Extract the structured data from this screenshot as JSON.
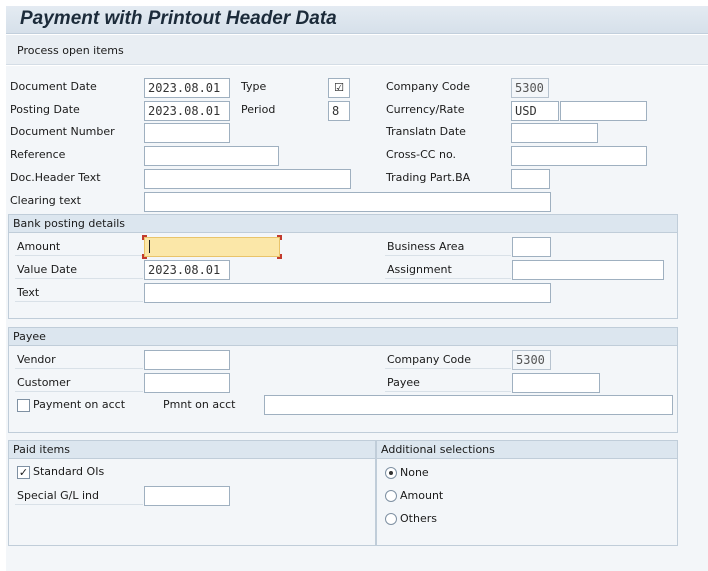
{
  "window": {
    "title": "Payment with Printout Header Data"
  },
  "toolbar": {
    "process_open_items": "Process open items"
  },
  "header": {
    "document_date": {
      "label": "Document Date",
      "value": "2023.08.01"
    },
    "type": {
      "label": "Type",
      "value": "☑"
    },
    "company_code": {
      "label": "Company Code",
      "value": "5300"
    },
    "posting_date": {
      "label": "Posting Date",
      "value": "2023.08.01"
    },
    "period": {
      "label": "Period",
      "value": "8"
    },
    "currency_rate": {
      "label": "Currency/Rate",
      "currency": "USD",
      "rate": ""
    },
    "document_number": {
      "label": "Document Number",
      "value": ""
    },
    "translatn_date": {
      "label": "Translatn Date",
      "value": ""
    },
    "reference": {
      "label": "Reference",
      "value": ""
    },
    "cross_cc_no": {
      "label": "Cross-CC no.",
      "value": ""
    },
    "doc_header_text": {
      "label": "Doc.Header Text",
      "value": ""
    },
    "trading_part_ba": {
      "label": "Trading Part.BA",
      "value": ""
    },
    "clearing_text": {
      "label": "Clearing text",
      "value": ""
    }
  },
  "bank": {
    "title": "Bank posting details",
    "amount": {
      "label": "Amount",
      "value": ""
    },
    "business_area": {
      "label": "Business Area",
      "value": ""
    },
    "value_date": {
      "label": "Value Date",
      "value": "2023.08.01"
    },
    "assignment": {
      "label": "Assignment",
      "value": ""
    },
    "text": {
      "label": "Text",
      "value": ""
    }
  },
  "payee": {
    "title": "Payee",
    "vendor": {
      "label": "Vendor",
      "value": ""
    },
    "company_code": {
      "label": "Company Code",
      "value": "5300"
    },
    "customer": {
      "label": "Customer",
      "value": ""
    },
    "payee": {
      "label": "Payee",
      "value": ""
    },
    "payment_on_acct": {
      "label": "Payment on acct",
      "checked": false
    },
    "pmnt_on_acct": {
      "label": "Pmnt on acct",
      "value": ""
    }
  },
  "paid_items": {
    "title": "Paid items",
    "standard_ois": {
      "label": "Standard OIs",
      "checked": true
    },
    "special_gl_ind": {
      "label": "Special G/L ind",
      "value": ""
    }
  },
  "additional_selections": {
    "title": "Additional selections",
    "options": [
      {
        "label": "None",
        "selected": true
      },
      {
        "label": "Amount",
        "selected": false
      },
      {
        "label": "Others",
        "selected": false
      }
    ]
  }
}
